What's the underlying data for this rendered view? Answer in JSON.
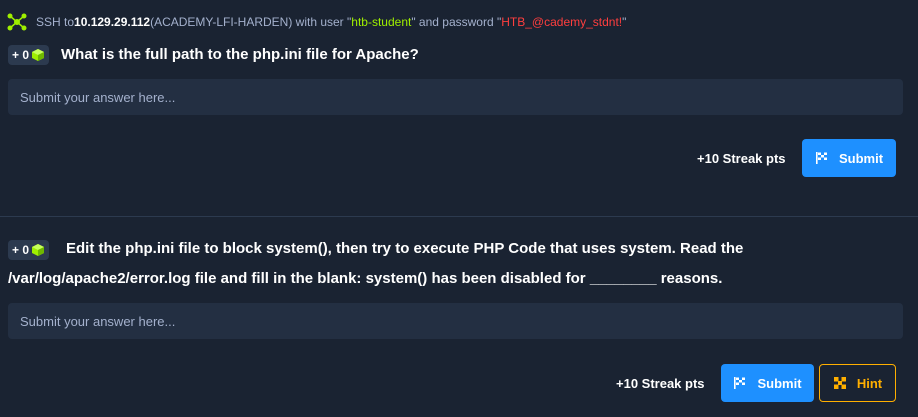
{
  "ssh": {
    "prefix": "SSH to ",
    "ip": "10.129.29.112",
    "host": " (ACADEMY-LFI-HARDEN) with user \"",
    "user": "htb-student",
    "mid": "\" and password \"",
    "password": "HTB_@cademy_stdnt!",
    "suffix": "\""
  },
  "questions": [
    {
      "points": "+ 0",
      "text": "What is the full path to the php.ini file for Apache?",
      "placeholder": "Submit your answer here...",
      "streak": "+10 Streak pts",
      "submit_label": "Submit"
    },
    {
      "points": "+ 0",
      "text": "Edit the php.ini file to block system(), then try to execute PHP Code that uses system. Read the /var/log/apache2/error.log file and fill in the blank: system() has been disabled for ________ reasons.",
      "placeholder": "Submit your answer here...",
      "streak": "+10 Streak pts",
      "submit_label": "Submit",
      "hint_label": "Hint"
    }
  ],
  "colors": {
    "background": "#1a2332",
    "field": "#232f42",
    "accent_green": "#9fef00",
    "accent_red": "#ff3e3e",
    "submit_blue": "#1e90ff",
    "hint_orange": "#ffaf00"
  },
  "icons": {
    "ssh": "network-nodes-icon",
    "points": "cube-icon",
    "submit": "flag-icon",
    "hint": "hint-icon"
  }
}
